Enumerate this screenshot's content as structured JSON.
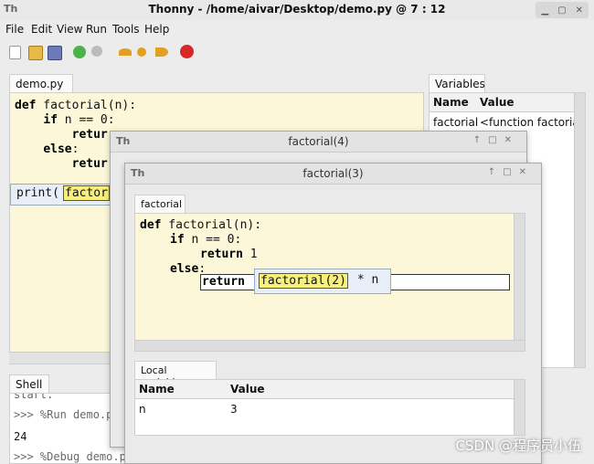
{
  "window": {
    "title": "Thonny  -  /home/aivar/Desktop/demo.py  @  7 : 12"
  },
  "menu": [
    "File",
    "Edit",
    "View",
    "Run",
    "Tools",
    "Help"
  ],
  "editor": {
    "tab_label": "demo.py",
    "lines": [
      {
        "kw": "def",
        "rest": " factorial(n):"
      },
      {
        "indent": "    ",
        "kw": "if",
        "rest": " n == 0:"
      },
      {
        "indent": "        ",
        "kw": "retur",
        "rest": ""
      },
      {
        "indent": "    ",
        "kw": "else",
        "rest": ":"
      },
      {
        "indent": "        ",
        "kw": "retur",
        "rest": ""
      }
    ],
    "call_line_prefix": "print(",
    "call_line_hl": "factor"
  },
  "variables": {
    "tab_label": "Variables",
    "col_name": "Name",
    "col_value": "Value",
    "rows": [
      {
        "name": "factorial",
        "value": "<function factorial"
      }
    ]
  },
  "shell": {
    "tab_label": "Shell",
    "lines": [
      "start.",
      ">>> %Run demo.p",
      "24",
      ">>> %Debug demo.py"
    ]
  },
  "dialog4": {
    "title": "factorial(4)"
  },
  "dialog3": {
    "title": "factorial(3)",
    "tab_label": "factorial",
    "code": {
      "l1_kw": "def",
      "l1_rest": " factorial(n):",
      "l2_kw": "if",
      "l2_rest": " n == 0:",
      "l3_kw": "return",
      "l3_rest": " 1",
      "l4_kw": "else",
      "l4_rest": ":",
      "l5_kw": "return",
      "l5_hl": "factorial(2)",
      "l5_rest": " * n"
    },
    "locals_tab": "Local variables",
    "col_name": "Name",
    "col_value": "Value",
    "rows": [
      {
        "name": "n",
        "value": "3"
      }
    ]
  },
  "watermark": "CSDN @程序员小伍"
}
